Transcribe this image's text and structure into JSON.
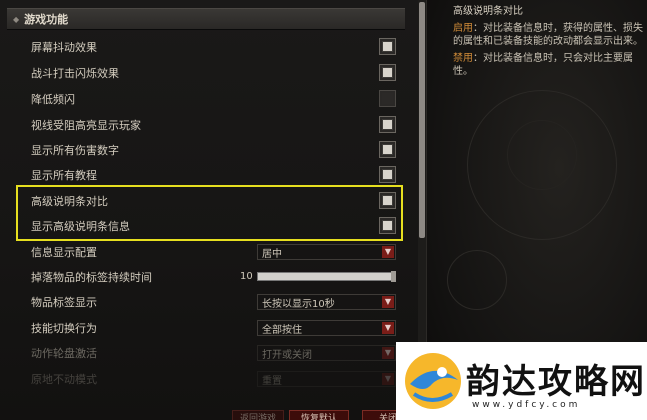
{
  "section": {
    "title": "游戏功能",
    "toggle_icon": "collapse-diamond-icon"
  },
  "toggle_rows": [
    {
      "label": "屏幕抖动效果",
      "checked": true
    },
    {
      "label": "战斗打击闪烁效果",
      "checked": true
    },
    {
      "label": "降低频闪",
      "checked": false
    },
    {
      "label": "视线受阻高亮显示玩家",
      "checked": true
    },
    {
      "label": "显示所有伤害数字",
      "checked": true
    },
    {
      "label": "显示所有教程",
      "checked": true
    },
    {
      "label": "高级说明条对比",
      "checked": true
    },
    {
      "label": "显示高级说明条信息",
      "checked": true
    }
  ],
  "info_display": {
    "label": "信息显示配置",
    "value": "居中"
  },
  "drop_tag_duration": {
    "label": "掉落物品的标签持续时间",
    "value": "10",
    "fill_fraction": 1.0
  },
  "item_label_display": {
    "label": "物品标签显示",
    "value": "长按以显示10秒"
  },
  "skill_switch": {
    "label": "技能切换行为",
    "value": "全部按住"
  },
  "action_wheel": {
    "label": "动作轮盘激活",
    "value": "打开或关闭"
  },
  "partial_row": {
    "label": "原地不动模式",
    "value": "重置"
  },
  "bottom_buttons": {
    "left": "返回游戏",
    "middle": "恢复默认",
    "right": "关闭"
  },
  "info_panel": {
    "title": "高级说明条对比",
    "enabled_keyword": "启用",
    "enabled_text": "：对比装备信息时，获得的属性、损失的属性和已装备技能的改动都会显示出来。",
    "disabled_keyword": "禁用",
    "disabled_text": "：对比装备信息时，只会对比主要属性。"
  },
  "watermark": {
    "title": "韵达攻略网",
    "url": "www.ydfcy.com"
  },
  "colors": {
    "highlight": "#e6df1f",
    "keyword": "#d08b38",
    "dropdown_arrow": "#7a1d18"
  }
}
